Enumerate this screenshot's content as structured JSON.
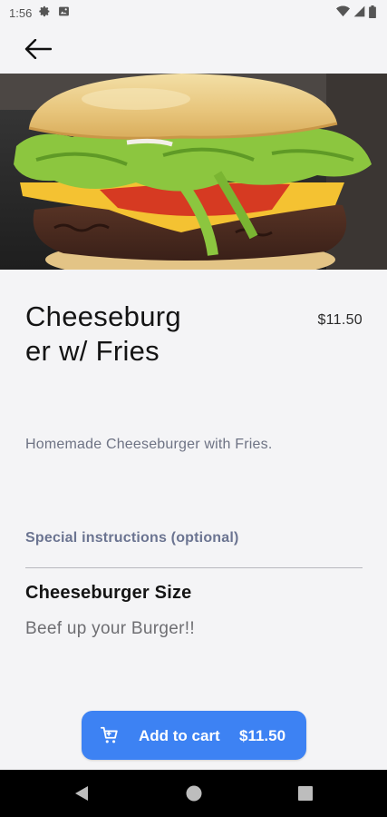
{
  "status_bar": {
    "time": "1:56",
    "left_icons": [
      "gear-icon",
      "image-icon"
    ],
    "right_icons": [
      "wifi-icon",
      "signal-icon",
      "battery-icon"
    ]
  },
  "app_bar": {
    "back_icon": "arrow-left-icon"
  },
  "item": {
    "title": "Cheeseburger w/ Fries",
    "price": "$11.50",
    "description": "Homemade Cheeseburger with Fries."
  },
  "special_instructions": {
    "label": "Special instructions (optional)"
  },
  "option_group": {
    "title": "Cheeseburger Size",
    "subtitle": "Beef up your Burger!!"
  },
  "add_to_cart": {
    "icon": "cart-icon",
    "label": "Add to cart",
    "price": "$11.50"
  },
  "nav_bar": {
    "buttons": [
      "back-triangle-icon",
      "home-circle-icon",
      "recents-square-icon"
    ]
  },
  "colors": {
    "accent": "#3d82f3",
    "background": "#f4f4f6",
    "muted_text": "#6e7384",
    "label_text": "#6b7491"
  }
}
